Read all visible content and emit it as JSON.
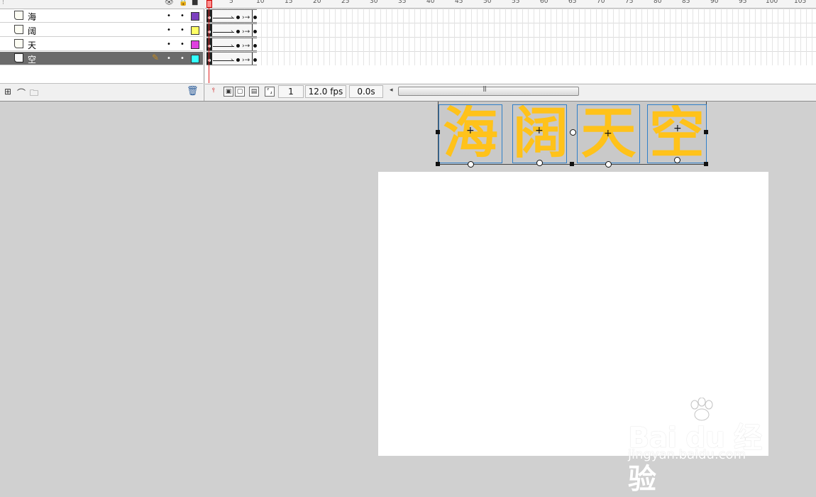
{
  "layers": [
    {
      "name": "海",
      "color": "#7b3fbf",
      "selected": false
    },
    {
      "name": "阔",
      "color": "#ffff66",
      "selected": false
    },
    {
      "name": "天",
      "color": "#e040e0",
      "selected": false
    },
    {
      "name": "空",
      "color": "#33ffff",
      "selected": true
    }
  ],
  "ruler": {
    "ticks": [
      "5",
      "10",
      "15",
      "20",
      "25",
      "30",
      "35",
      "40",
      "45",
      "50",
      "55",
      "60",
      "65",
      "70",
      "75",
      "80",
      "85",
      "90",
      "95",
      "100",
      "105"
    ]
  },
  "timeline_footer": {
    "current_frame": "1",
    "frame_rate": "12.0 fps",
    "elapsed": "0.0s"
  },
  "stage": {
    "characters": [
      "海",
      "阔",
      "天",
      "空"
    ],
    "text_color": "#ffc21a"
  },
  "watermark": {
    "brand": "Bai du 经验",
    "url": "jingyan.baidu.com"
  }
}
